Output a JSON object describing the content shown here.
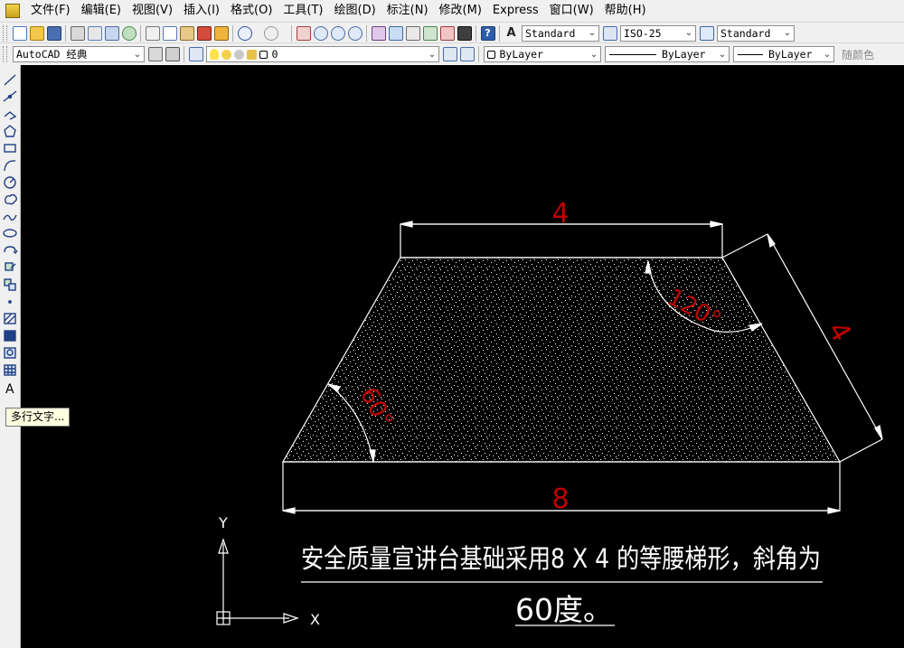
{
  "menubar": {
    "items": [
      "文件(F)",
      "编辑(E)",
      "视图(V)",
      "插入(I)",
      "格式(O)",
      "工具(T)",
      "绘图(D)",
      "标注(N)",
      "修改(M)",
      "Express",
      "窗口(W)",
      "帮助(H)"
    ]
  },
  "toolbar1": {
    "text_style": "Standard",
    "dim_style": "ISO-25",
    "table_style": "Standard"
  },
  "toolbar2": {
    "workspace": "AutoCAD 经典",
    "layer": "0",
    "color": "ByLayer",
    "linetype": "ByLayer",
    "lineweight": "ByLayer",
    "plot_style": "随颜色"
  },
  "tooltip": {
    "text": "多行文字..."
  },
  "drawing": {
    "dim_top": "4",
    "dim_bottom": "8",
    "dim_side": "4",
    "angle_obtuse": "120°",
    "angle_acute": "60°",
    "note_line1": "安全质量宣讲台基础采用8 X 4 的等腰梯形，斜角为",
    "note_line2": "60度。",
    "ucs_x": "X",
    "ucs_y": "Y"
  },
  "colors": {
    "dimension_text": "#c00000",
    "geometry": "#ffffff",
    "background": "#000000"
  }
}
